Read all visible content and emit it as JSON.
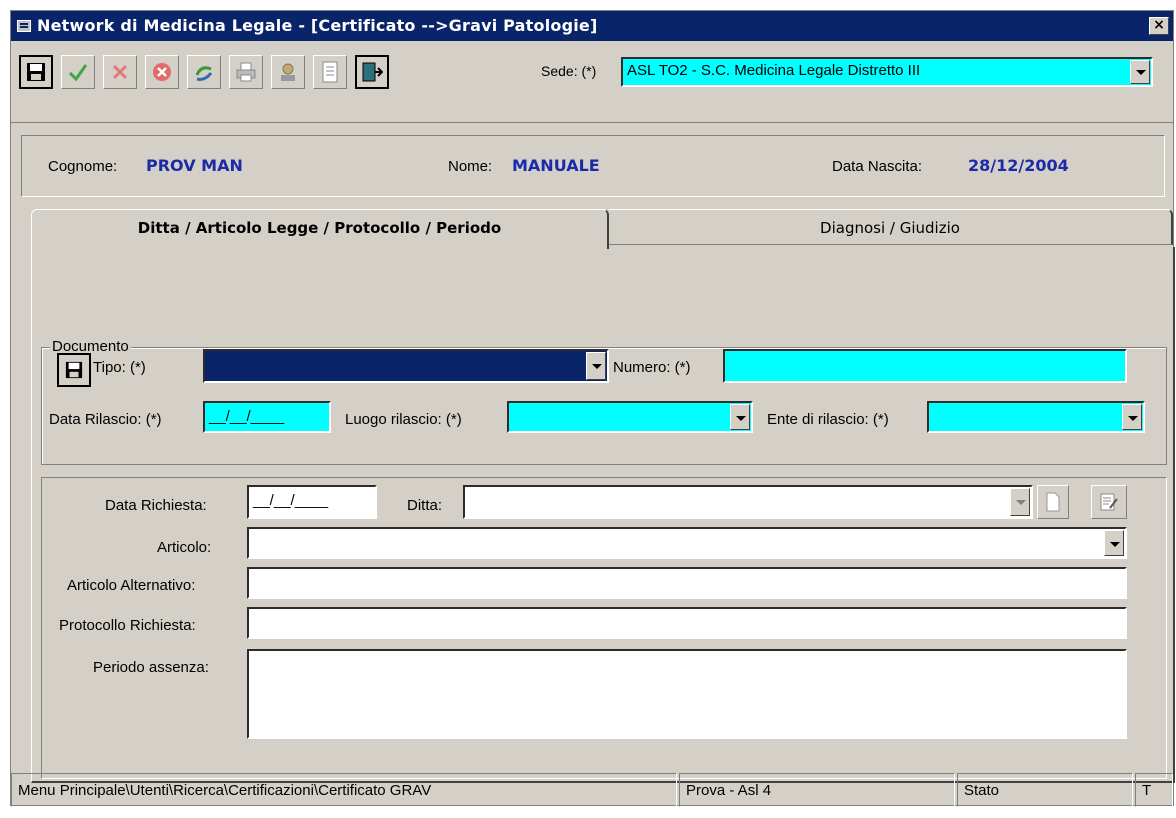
{
  "window": {
    "title": "Network di Medicina Legale - [Certificato -->Gravi Patologie]",
    "close_glyph": "×"
  },
  "toolbar": {
    "buttons": [
      "save-icon",
      "confirm-check-icon",
      "cancel-x-icon",
      "delete-icon",
      "refresh-icon",
      "print-icon",
      "user-icon",
      "document-icon",
      "exit-door-icon"
    ],
    "sede_label": "Sede: (*)",
    "sede_value": "ASL TO2 - S.C. Medicina Legale Distretto III"
  },
  "patient": {
    "surname_label": "Cognome:",
    "surname_value": "PROV MAN",
    "name_label": "Nome:",
    "name_value": "MANUALE",
    "birth_label": "Data Nascita:",
    "birth_value": "28/12/2004"
  },
  "tabs": [
    {
      "label": "Ditta / Articolo Legge / Protocollo / Periodo",
      "active": true
    },
    {
      "label": "Diagnosi / Giudizio",
      "active": false
    }
  ],
  "documento": {
    "legend": "Documento",
    "tipo_label": "Tipo: (*)",
    "tipo_value": "",
    "numero_label": "Numero: (*)",
    "numero_value": "",
    "data_rilascio_label": "Data Rilascio: (*)",
    "data_rilascio_value": "__/__/____",
    "luogo_label": "Luogo rilascio: (*)",
    "luogo_value": "",
    "ente_label": "Ente di rilascio: (*)",
    "ente_value": ""
  },
  "richiesta": {
    "data_label": "Data Richiesta:",
    "data_value": "__/__/____",
    "ditta_label": "Ditta:",
    "ditta_value": "",
    "articolo_label": "Articolo:",
    "articolo_value": "",
    "articolo_alt_label": "Articolo Alternativo:",
    "articolo_alt_value": "",
    "protocollo_label": "Protocollo Richiesta:",
    "protocollo_value": "",
    "periodo_label": "Periodo assenza:",
    "periodo_value": ""
  },
  "statusbar": {
    "path": "Menu Principale\\Utenti\\Ricerca\\Certificazioni\\Certificato GRAV",
    "env": "Prova - Asl 4",
    "stato": "Stato",
    "t": "T"
  },
  "colors": {
    "titlebar": "#0a246a",
    "required_field": "#00ffff",
    "value_text": "#1a2aa8",
    "face": "#d4d0c8"
  }
}
